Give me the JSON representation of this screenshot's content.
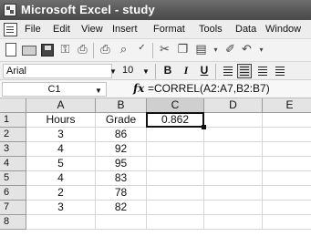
{
  "title_bar": {
    "icon": "excel-app-icon",
    "title": "Microsoft Excel - study"
  },
  "menu": {
    "items": [
      "File",
      "Edit",
      "View",
      "Insert",
      "Format",
      "Tools",
      "Data",
      "Window"
    ]
  },
  "standard_toolbar": {
    "buttons": [
      "new-icon",
      "open-icon",
      "save-icon",
      "permission-icon",
      "print-preview-icon",
      "print-icon",
      "research-icon",
      "spelling-icon",
      "cut-icon",
      "copy-icon",
      "paste-icon",
      "format-painter-icon",
      "undo-icon"
    ]
  },
  "formatting_toolbar": {
    "font": "Arial",
    "font_size": "10",
    "bold": "B",
    "italic": "I",
    "underline": "U",
    "align_buttons": [
      "align-left-icon",
      "center-icon",
      "align-right-icon",
      "merge-center-icon"
    ]
  },
  "formula_bar": {
    "name_box": "C1",
    "fx": "fx",
    "formula": "=CORREL(A2:A7,B2:B7)"
  },
  "sheet": {
    "columns": [
      "A",
      "B",
      "C",
      "D",
      "E"
    ],
    "rows": [
      "1",
      "2",
      "3",
      "4",
      "5",
      "6",
      "7",
      "8"
    ],
    "cells": [
      [
        "Hours",
        "Grade",
        "0.862",
        "",
        ""
      ],
      [
        "3",
        "86",
        "",
        "",
        ""
      ],
      [
        "4",
        "92",
        "",
        "",
        ""
      ],
      [
        "5",
        "95",
        "",
        "",
        ""
      ],
      [
        "4",
        "83",
        "",
        "",
        ""
      ],
      [
        "2",
        "78",
        "",
        "",
        ""
      ],
      [
        "3",
        "82",
        "",
        "",
        ""
      ],
      [
        "",
        "",
        "",
        "",
        ""
      ]
    ],
    "active_cell": "C1"
  }
}
